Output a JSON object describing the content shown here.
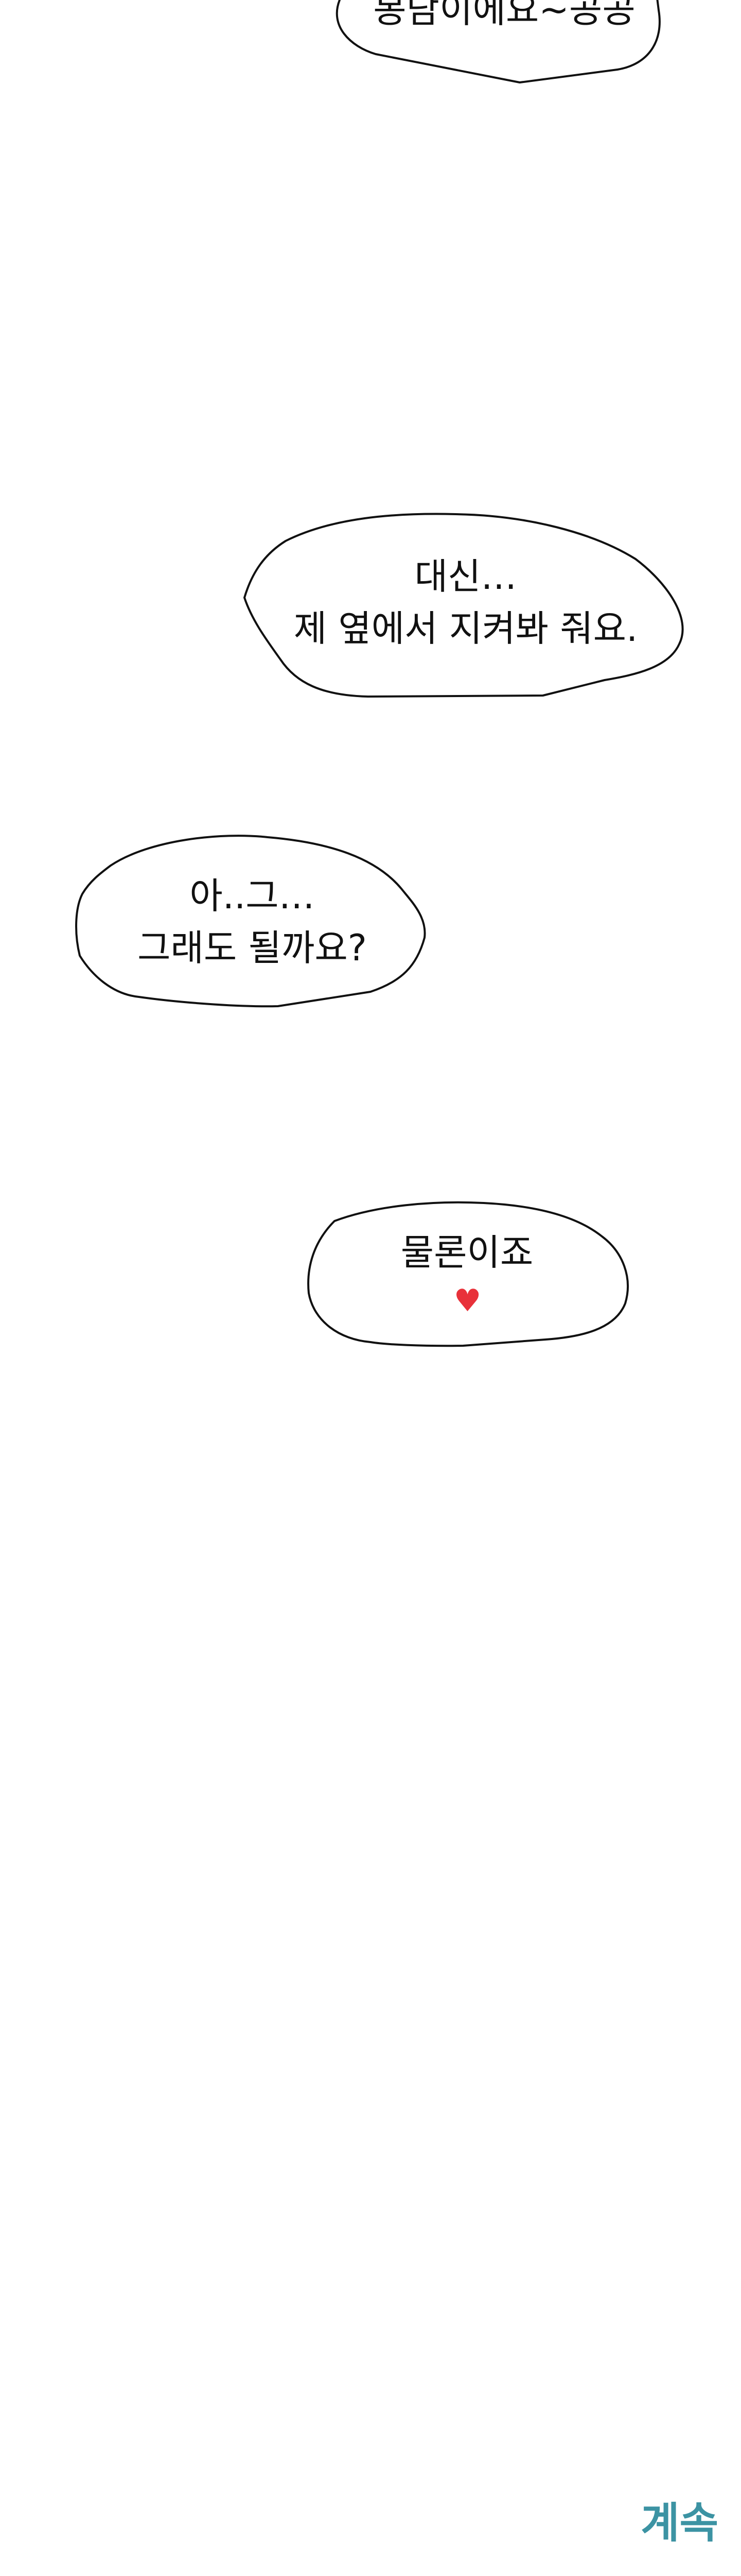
{
  "bubbles": [
    {
      "lines": [
        "봉담이에요~공공"
      ]
    },
    {
      "lines": [
        "대신…",
        "제 옆에서 지켜봐 줘요."
      ]
    },
    {
      "lines": [
        "아..그…",
        "그래도 될까요?"
      ]
    },
    {
      "lines": [
        "물론이죠"
      ],
      "heart": "♥"
    }
  ],
  "continue_label": "계속",
  "colors": {
    "heart": "#e8313a",
    "continue": "#3c93a3",
    "outline": "#111111"
  }
}
